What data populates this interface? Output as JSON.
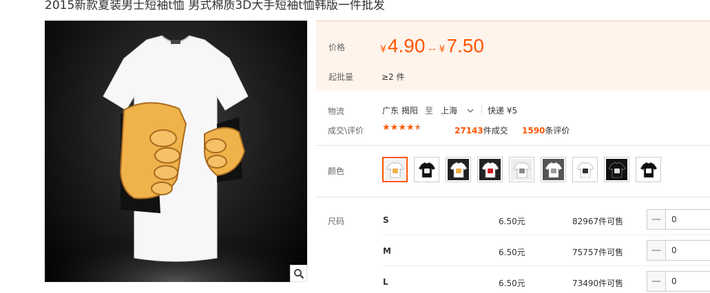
{
  "title": "2015新款夏装男士短袖t恤 男式棉质3D大手短袖t恤韩版一件批发",
  "price": {
    "label": "价格",
    "currency": "¥",
    "low": "4.90",
    "separator": "--",
    "high": "7.50"
  },
  "min_order": {
    "label": "起批量",
    "value": "≥2 件"
  },
  "logistics": {
    "label": "物流",
    "from": "广东 揭阳",
    "to_word": "至",
    "to": "上海",
    "shipping": "快递 ¥5"
  },
  "deals": {
    "label": "成交\\评价",
    "rating_stars": 4.5,
    "deal_count": "27143",
    "deal_suffix": "件成交",
    "review_count": "1590",
    "review_suffix": "条评价"
  },
  "color": {
    "label": "颜色",
    "selected_index": 0
  },
  "size": {
    "label": "尺码",
    "rows": [
      {
        "size": "S",
        "price": "6.50元",
        "stock": "82967件可售",
        "qty": "0"
      },
      {
        "size": "M",
        "price": "6.50元",
        "stock": "75757件可售",
        "qty": "0"
      },
      {
        "size": "L",
        "price": "6.50元",
        "stock": "73490件可售",
        "qty": "0"
      }
    ]
  },
  "icons": {
    "zoom": "search-icon",
    "dropdown": "chevron-down-icon",
    "minus": "minus-icon"
  },
  "colors": {
    "accent": "#ff5500",
    "price_bg": "#fff4ec"
  }
}
